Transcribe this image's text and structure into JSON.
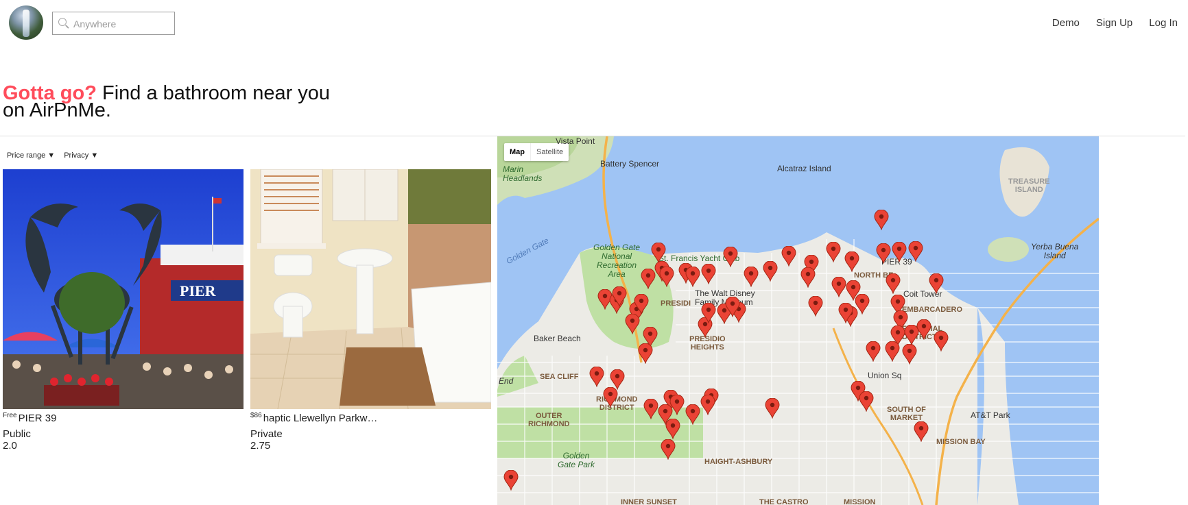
{
  "header": {
    "search_placeholder": "Anywhere",
    "nav": [
      "Demo",
      "Sign Up",
      "Log In"
    ]
  },
  "hero": {
    "accent": "Gotta go?",
    "line1_rest": " Find a bathroom near you",
    "line2": "on AirPnMe."
  },
  "filters": {
    "price_range": "Price range ▼",
    "privacy": "Privacy ▼"
  },
  "listings": [
    {
      "price": "Free",
      "name": "PIER 39",
      "privacy": "Public",
      "rating": "2.0"
    },
    {
      "price": "$86",
      "name": "haptic Llewellyn Parkw…",
      "privacy": "Private",
      "rating": "2.75"
    }
  ],
  "map": {
    "type_map": "Map",
    "type_satellite": "Satellite",
    "labels": {
      "vista_point": "Vista Point",
      "battery_spencer": "Battery Spencer",
      "marin_headlands": "Marin\nHeadlands",
      "alcatraz": "Alcatraz Island",
      "treasure_island": "TREASURE\nISLAND",
      "golden_gate": "Golden Gate",
      "ggnra": "Golden Gate\nNational\nRecreation\nArea",
      "st_francis": "St. Francis Yacht Club",
      "pier39": "PIER 39",
      "yerba_buena": "Yerba Buena\nIsland",
      "walt_disney": "The Walt Disney\nFamily Museum",
      "north_beach": "NORTH BE",
      "coit_tower": "Coit Tower",
      "embarcadero": "EMBARCADERO",
      "baker_beach": "Baker Beach",
      "financial_district": "FINANCIAL\nDISTRICT",
      "presidio_heights": "PRESIDIO\nHEIGHTS",
      "sea_cliff": "SEA CLIFF",
      "end": "End",
      "richmond": "RICHMOND\nDISTRICT",
      "outer_richmond": "OUTER\nRICHMOND",
      "south_of_market": "SOUTH OF\nMARKET",
      "att_park": "AT&T Park",
      "mission_bay": "MISSION BAY",
      "golden_gate_park": "Golden\nGate Park",
      "haight_ashbury": "HAIGHT-ASHBURY",
      "inner_sunset": "INNER SUNSET",
      "castro": "THE CASTRO",
      "mission": "MISSION",
      "union_sq": "Union Sq",
      "presidio": "PRESIDI"
    },
    "pin_count": 62
  }
}
